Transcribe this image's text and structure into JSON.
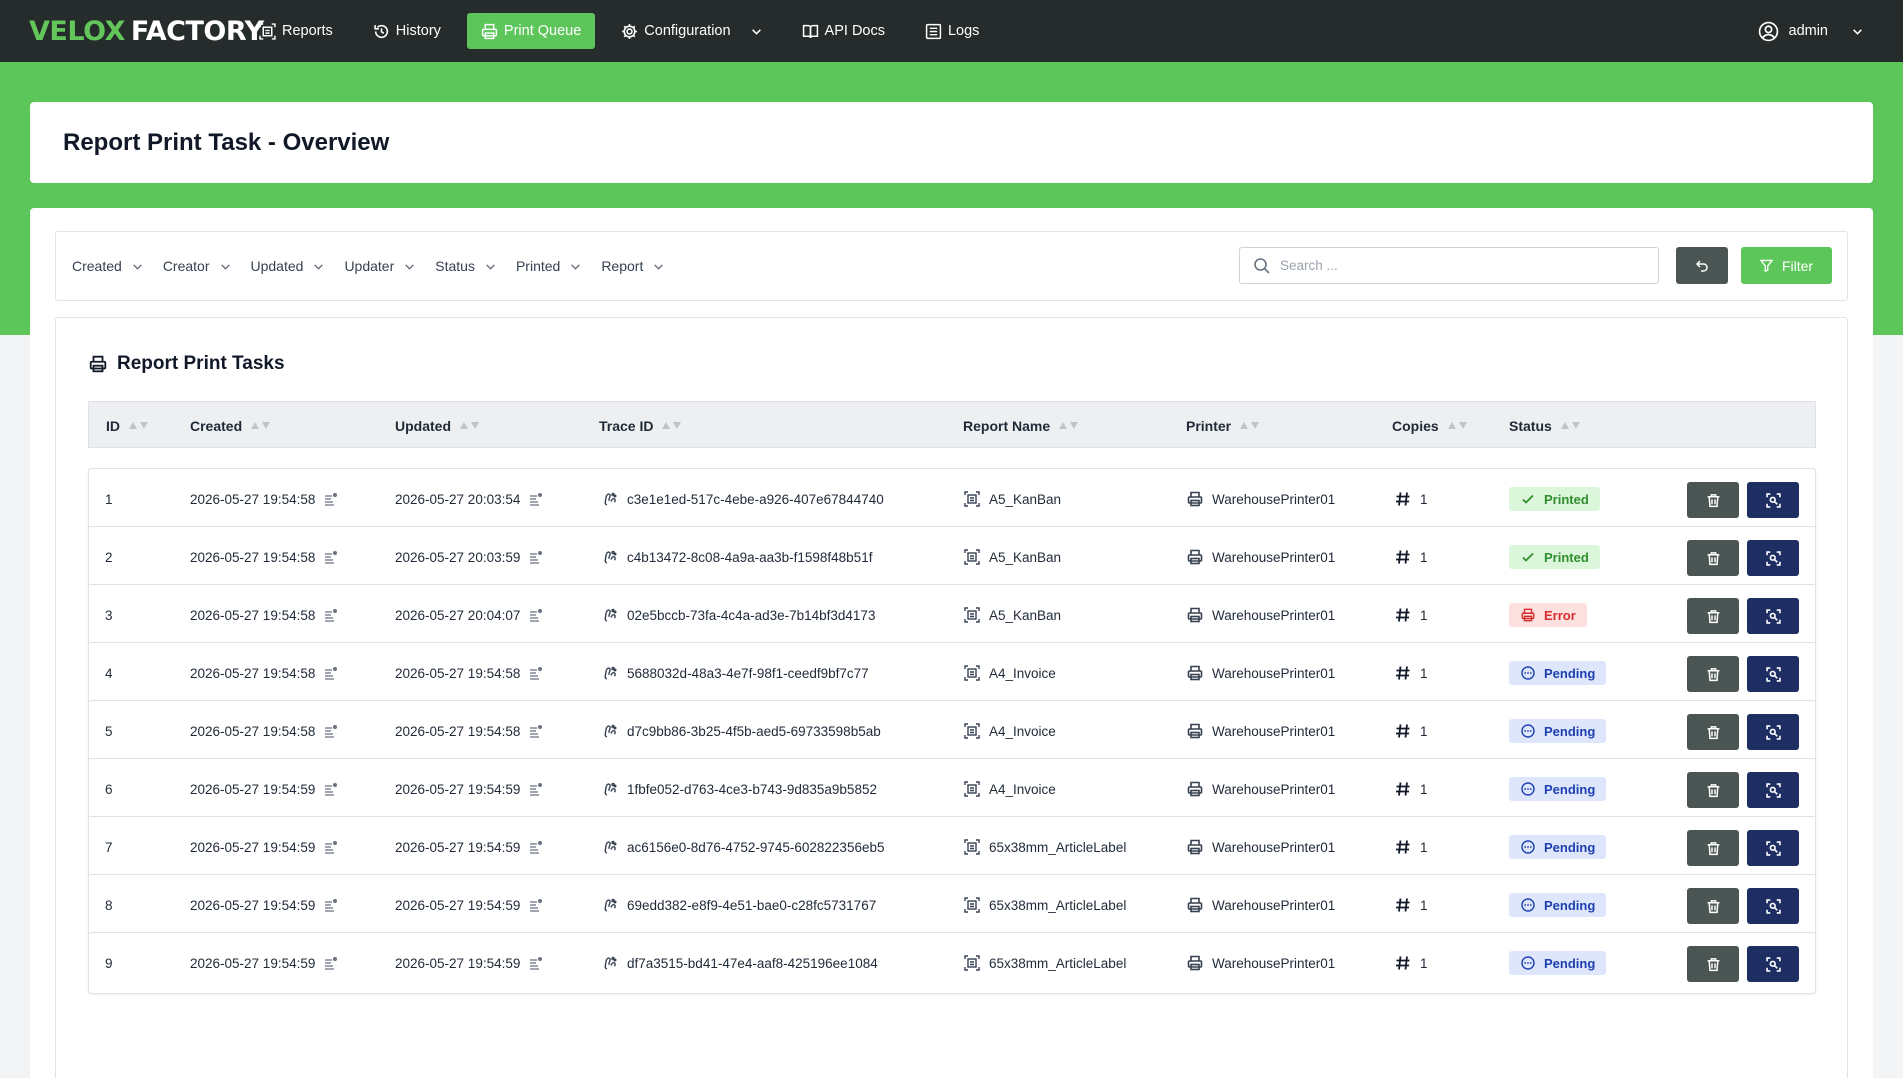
{
  "brand": {
    "part1": "VELOX",
    "part2": "FACTORY"
  },
  "nav": {
    "items": [
      {
        "label": "Reports",
        "icon": "report-icon"
      },
      {
        "label": "History",
        "icon": "history-icon"
      },
      {
        "label": "Print Queue",
        "icon": "printer-icon",
        "active": true
      },
      {
        "label": "Configuration",
        "icon": "gear-icon",
        "dropdown": true
      },
      {
        "label": "API Docs",
        "icon": "book-icon"
      },
      {
        "label": "Logs",
        "icon": "list-icon"
      }
    ],
    "user": "admin"
  },
  "page": {
    "title": "Report Print Task - Overview"
  },
  "filters": {
    "items": [
      "Created",
      "Creator",
      "Updated",
      "Updater",
      "Status",
      "Printed",
      "Report"
    ],
    "search_placeholder": "Search ...",
    "filter_label": "Filter"
  },
  "table": {
    "title": "Report Print Tasks",
    "columns": [
      "ID",
      "Created",
      "Updated",
      "Trace ID",
      "Report Name",
      "Printer",
      "Copies",
      "Status"
    ],
    "rows": [
      {
        "id": "1",
        "created": "2026-05-27 19:54:58",
        "updated": "2026-05-27 20:03:54",
        "trace": "c3e1e1ed-517c-4ebe-a926-407e67844740",
        "report": "A5_KanBan",
        "printer": "WarehousePrinter01",
        "copies": "1",
        "status": "Printed"
      },
      {
        "id": "2",
        "created": "2026-05-27 19:54:58",
        "updated": "2026-05-27 20:03:59",
        "trace": "c4b13472-8c08-4a9a-aa3b-f1598f48b51f",
        "report": "A5_KanBan",
        "printer": "WarehousePrinter01",
        "copies": "1",
        "status": "Printed"
      },
      {
        "id": "3",
        "created": "2026-05-27 19:54:58",
        "updated": "2026-05-27 20:04:07",
        "trace": "02e5bccb-73fa-4c4a-ad3e-7b14bf3d4173",
        "report": "A5_KanBan",
        "printer": "WarehousePrinter01",
        "copies": "1",
        "status": "Error"
      },
      {
        "id": "4",
        "created": "2026-05-27 19:54:58",
        "updated": "2026-05-27 19:54:58",
        "trace": "5688032d-48a3-4e7f-98f1-ceedf9bf7c77",
        "report": "A4_Invoice",
        "printer": "WarehousePrinter01",
        "copies": "1",
        "status": "Pending"
      },
      {
        "id": "5",
        "created": "2026-05-27 19:54:58",
        "updated": "2026-05-27 19:54:58",
        "trace": "d7c9bb86-3b25-4f5b-aed5-69733598b5ab",
        "report": "A4_Invoice",
        "printer": "WarehousePrinter01",
        "copies": "1",
        "status": "Pending"
      },
      {
        "id": "6",
        "created": "2026-05-27 19:54:59",
        "updated": "2026-05-27 19:54:59",
        "trace": "1fbfe052-d763-4ce3-b743-9d835a9b5852",
        "report": "A4_Invoice",
        "printer": "WarehousePrinter01",
        "copies": "1",
        "status": "Pending"
      },
      {
        "id": "7",
        "created": "2026-05-27 19:54:59",
        "updated": "2026-05-27 19:54:59",
        "trace": "ac6156e0-8d76-4752-9745-602822356eb5",
        "report": "65x38mm_ArticleLabel",
        "printer": "WarehousePrinter01",
        "copies": "1",
        "status": "Pending"
      },
      {
        "id": "8",
        "created": "2026-05-27 19:54:59",
        "updated": "2026-05-27 19:54:59",
        "trace": "69edd382-e8f9-4e51-bae0-c28fc5731767",
        "report": "65x38mm_ArticleLabel",
        "printer": "WarehousePrinter01",
        "copies": "1",
        "status": "Pending"
      },
      {
        "id": "9",
        "created": "2026-05-27 19:54:59",
        "updated": "2026-05-27 19:54:59",
        "trace": "df7a3515-bd41-47e4-aaf8-425196ee1084",
        "report": "65x38mm_ArticleLabel",
        "printer": "WarehousePrinter01",
        "copies": "1",
        "status": "Pending"
      }
    ]
  },
  "colors": {
    "navbar": "#262b2b",
    "accent_green": "#5cc65b",
    "dark_button": "#4b5553",
    "navy_button": "#1e2e63",
    "printed": "#2f8f2c",
    "error": "#d92d2d",
    "pending": "#1d3fb0"
  }
}
